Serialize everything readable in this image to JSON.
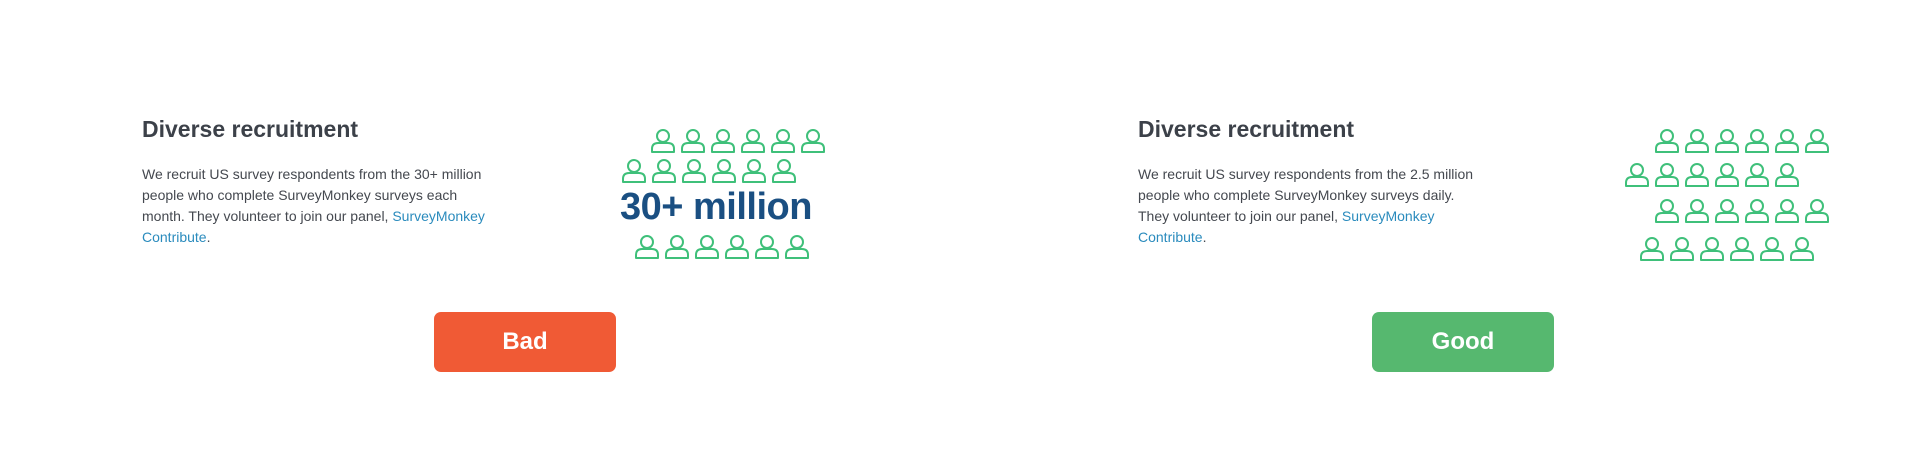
{
  "bad_example": {
    "heading": "Diverse recruitment",
    "body": "We recruit US survey respondents from the 30+ million people who complete SurveyMonkey surveys each month. They volunteer to join our panel,",
    "link": "SurveyMonkey Contribute",
    "suffix": ".",
    "stat": "30+ million",
    "verdict": "Bad"
  },
  "good_example": {
    "heading": "Diverse recruitment",
    "body": "We recruit US survey respondents from the 2.5 million people who complete SurveyMonkey surveys daily. They volunteer to join our panel,",
    "link": "SurveyMonkey Contribute",
    "suffix": ".",
    "verdict": "Good"
  },
  "colors": {
    "bad": "#f05a35",
    "good": "#56b86f",
    "icon": "#3fc07a",
    "stat": "#1a4f82",
    "link": "#2a8bbd"
  },
  "icons": {
    "person": "person-icon"
  }
}
